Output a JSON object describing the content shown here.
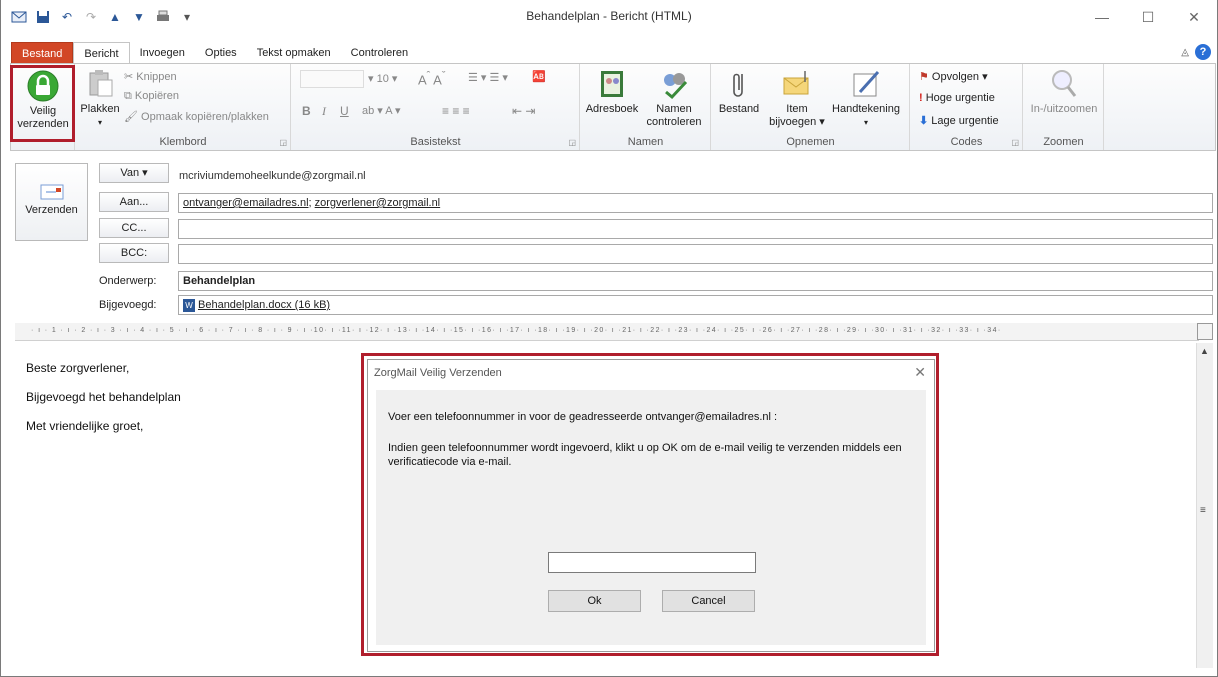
{
  "window": {
    "title": "Behandelplan - Bericht (HTML)"
  },
  "tabs": {
    "file": "Bestand",
    "message": "Bericht",
    "insert": "Invoegen",
    "options": "Opties",
    "format": "Tekst opmaken",
    "review": "Controleren"
  },
  "ribbon": {
    "secure": {
      "line1": "Veilig",
      "line2": "verzenden"
    },
    "clipboard": {
      "paste": "Plakken",
      "cut": "Knippen",
      "copy": "Kopiëren",
      "format_painter": "Opmaak kopiëren/plakken",
      "label": "Klembord"
    },
    "basictext": {
      "font_size": "10",
      "label": "Basistekst"
    },
    "names": {
      "address_book": "Adresboek",
      "check_line1": "Namen",
      "check_line2": "controleren",
      "label": "Namen"
    },
    "include": {
      "file": "Bestand",
      "item_line1": "Item",
      "item_line2": "bijvoegen ▾",
      "signature": "Handtekening",
      "label": "Opnemen"
    },
    "tags": {
      "follow_up": "Opvolgen ▾",
      "high": "Hoge urgentie",
      "low": "Lage urgentie",
      "label": "Codes"
    },
    "zoom": {
      "button": "In-/uitzoomen",
      "label": "Zoomen"
    }
  },
  "header": {
    "send": "Verzenden",
    "from_button": "Van ▾",
    "from_value": "mcriviumdemoheelkunde@zorgmail.nl",
    "to_button": "Aan...",
    "to_1": "ontvanger@emailadres.nl",
    "to_sep": "; ",
    "to_2": "zorgverlener@zorgmail.nl",
    "cc_button": "CC...",
    "bcc_button": "BCC:",
    "subject_label": "Onderwerp:",
    "subject_value": "Behandelplan",
    "attach_label": "Bijgevoegd:",
    "attach_value": "Behandelplan.docx (16 kB)"
  },
  "ruler": {
    "text": "· ı · 1 · ı · 2 · ı · 3 · ı · 4 · ı · 5 · ı · 6 · ı · 7 · ı · 8 · ı · 9 · ı ·10· ı ·11· ı ·12· ı ·13· ı ·14· ı ·15· ı ·16· ı ·17· ı ·18· ı ·19· ı ·20· ı ·21· ı ·22· ı ·23· ı ·24· ı ·25· ı ·26· ı ·27· ı ·28· ı ·29· ı ·30· ı ·31· ı ·32· ı ·33· ı ·34·"
  },
  "body": {
    "line1": "Beste zorgverlener,",
    "line2": "Bijgevoegd het behandelplan",
    "line3": "Met vriendelijke groet,"
  },
  "dialog": {
    "title": "ZorgMail Veilig Verzenden",
    "text1": "Voer een telefoonnummer in voor de geadresseerde ontvanger@emailadres.nl :",
    "text2": "Indien geen telefoonnummer wordt ingevoerd, klikt u op OK om de e-mail veilig te verzenden middels een verificatiecode via e-mail.",
    "input_value": "",
    "ok": "Ok",
    "cancel": "Cancel"
  },
  "colors": {
    "file_tab": "#d24726",
    "highlight": "#b01e2c",
    "lock": "#3aa835"
  }
}
